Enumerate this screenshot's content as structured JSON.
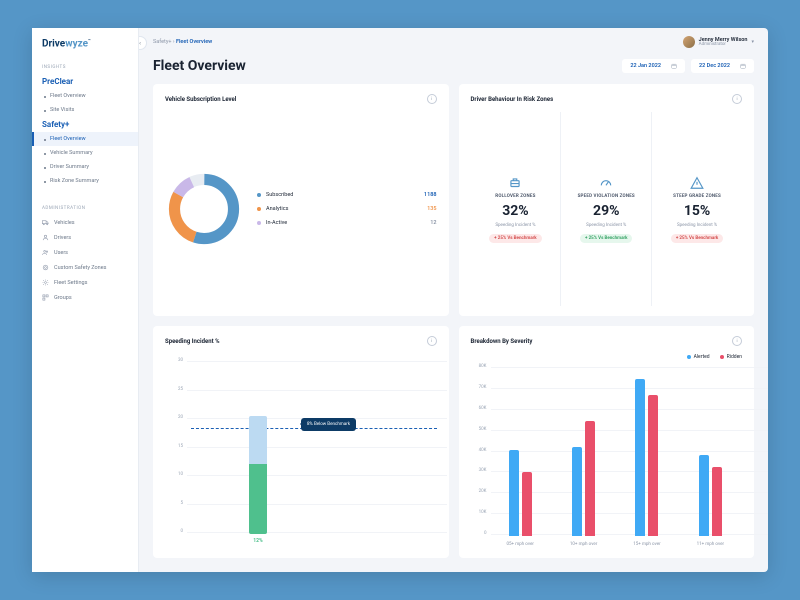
{
  "brand": {
    "part1": "Drive",
    "part2": "wyze",
    "tm": "™"
  },
  "breadcrumb": {
    "parent": "Safety+",
    "sep": "›",
    "current": "Fleet Overview"
  },
  "user": {
    "name": "Jenny Merry Wilson",
    "role": "Administrator"
  },
  "page_title": "Fleet Overview",
  "dates": {
    "from": "22 Jan 2022",
    "to": "22 Dec 2022"
  },
  "sidebar": {
    "insights_label": "INSIGHTS",
    "cat1": "PreClear",
    "cat1_items": [
      "Fleet Overview",
      "Site Visits"
    ],
    "cat2": "Safety+",
    "cat2_items": [
      "Fleet Overview",
      "Vehicle Summary",
      "Driver Summary",
      "Risk Zone Summary"
    ],
    "admin_label": "ADMINISTRATION",
    "admin_items": [
      "Vehicles",
      "Drivers",
      "Users",
      "Custom Safety Zones",
      "Fleet Settings",
      "Groups"
    ]
  },
  "cards": {
    "subscription": {
      "title": "Vehicle Subscription Level",
      "legend": [
        {
          "label": "Subscribed",
          "value": "1188",
          "color": "#5596c7"
        },
        {
          "label": "Analytics",
          "value": "135",
          "color": "#f0944a"
        },
        {
          "label": "In-Active",
          "value": "12",
          "color": "#c9b8e8"
        }
      ]
    },
    "behaviour": {
      "title": "Driver Behaviour In Risk Zones",
      "zones": [
        {
          "icon": "rollover",
          "label": "ROLLOVER ZONES",
          "value": "32%",
          "sub": "Speeding Incident %",
          "badge": "+ 25% Vs Benchmark",
          "badge_class": "bad"
        },
        {
          "icon": "speed",
          "label": "SPEED VIOLATION ZONES",
          "value": "29%",
          "sub": "Speeding Incident %",
          "badge": "+ 25% Vs Benchmark",
          "badge_class": "good"
        },
        {
          "icon": "grade",
          "label": "STEEP GRADE ZONES",
          "value": "15%",
          "sub": "Speeding Incident %",
          "badge": "+ 25% Vs Benchmark",
          "badge_class": "bad"
        }
      ]
    },
    "speeding": {
      "title": "Speeding Incident %",
      "tooltip": "8% Below Benchmark",
      "bar_label": "12%"
    },
    "breakdown": {
      "title": "Breakdown By Severity",
      "legend": [
        "Alerted",
        "Ridden"
      ]
    }
  },
  "chart_data": [
    {
      "type": "pie",
      "title": "Vehicle Subscription Level",
      "categories": [
        "Subscribed",
        "Analytics",
        "In-Active"
      ],
      "values": [
        1188,
        135,
        12
      ],
      "colors": [
        "#5596c7",
        "#f0944a",
        "#c9b8e8"
      ]
    },
    {
      "type": "bar",
      "title": "Speeding Incident %",
      "categories": [
        "Fleet"
      ],
      "series": [
        {
          "name": "Benchmark",
          "values": [
            20
          ]
        },
        {
          "name": "Fleet",
          "values": [
            12
          ]
        }
      ],
      "ylabel": "%",
      "ylim": [
        0,
        30
      ],
      "y_ticks": [
        0,
        5,
        10,
        15,
        20,
        25,
        30
      ],
      "annotation": "8% Below Benchmark"
    },
    {
      "type": "bar",
      "title": "Breakdown By Severity",
      "categories": [
        "05+ mph over",
        "10+ mph over",
        "15+ mph over",
        "11+ mph over"
      ],
      "series": [
        {
          "name": "Alerted",
          "values": [
            40000,
            42000,
            73000,
            38000
          ],
          "color": "#3fa9f5"
        },
        {
          "name": "Ridden",
          "values": [
            30000,
            54000,
            66000,
            32000
          ],
          "color": "#e94f6a"
        }
      ],
      "ylabel": "",
      "ylim": [
        0,
        80000
      ],
      "y_ticks": [
        0,
        10000,
        20000,
        30000,
        40000,
        50000,
        60000,
        70000,
        80000
      ],
      "y_tick_labels": [
        "0",
        "10K",
        "20K",
        "30K",
        "40K",
        "50K",
        "60K",
        "70K",
        "80K"
      ]
    }
  ]
}
